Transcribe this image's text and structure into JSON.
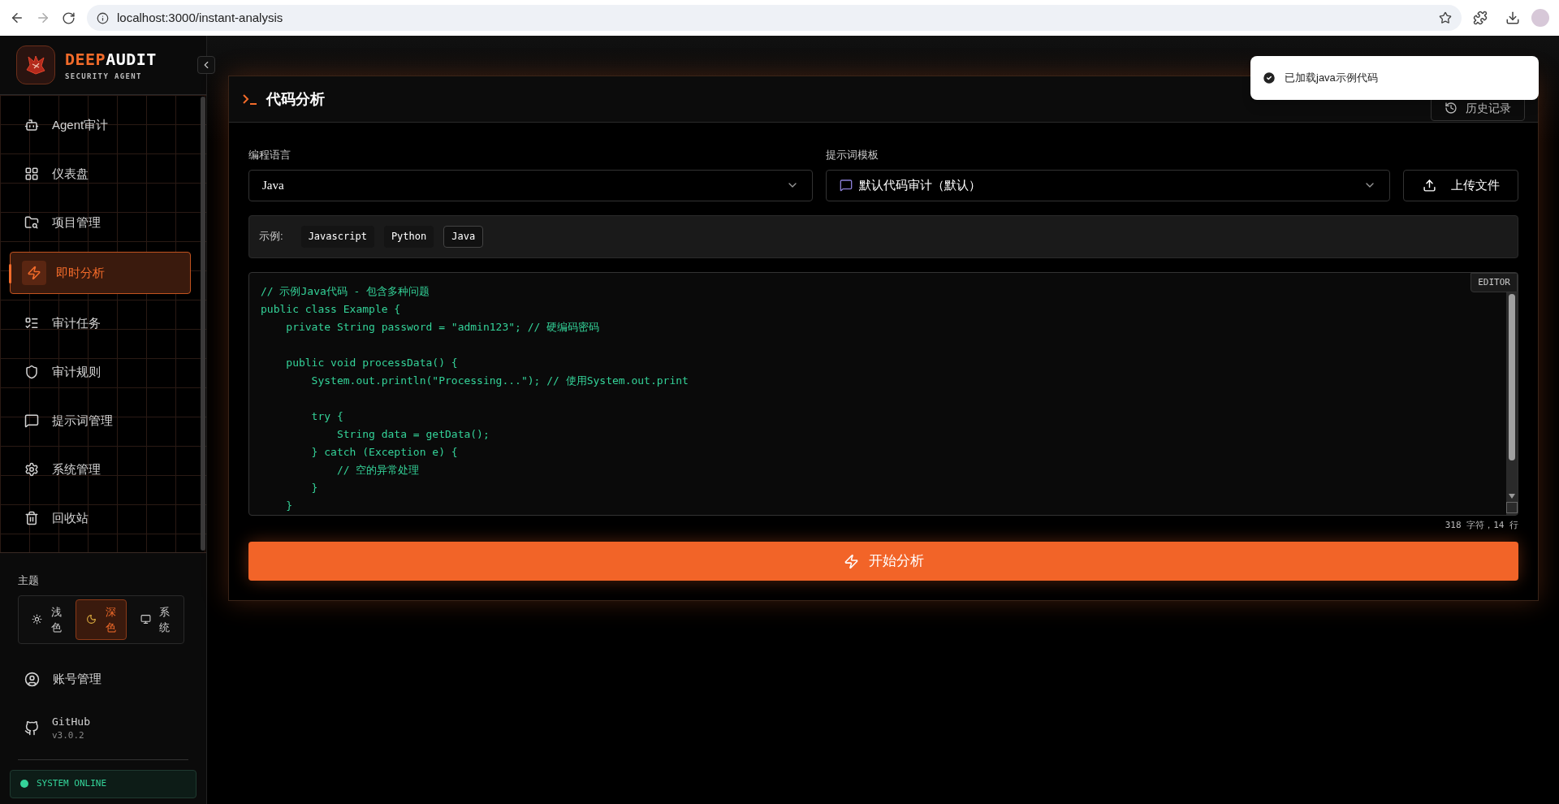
{
  "browser": {
    "url": "localhost:3000/instant-analysis"
  },
  "sidebar": {
    "brand": {
      "accent": "DEEP",
      "name": "AUDIT",
      "tagline": "SECURITY AGENT"
    },
    "items": [
      {
        "label": "Agent审计",
        "selected": false
      },
      {
        "label": "仪表盘",
        "selected": false
      },
      {
        "label": "项目管理",
        "selected": false
      },
      {
        "label": "即时分析",
        "selected": true
      },
      {
        "label": "审计任务",
        "selected": false
      },
      {
        "label": "审计规则",
        "selected": false
      },
      {
        "label": "提示词管理",
        "selected": false
      },
      {
        "label": "系统管理",
        "selected": false
      },
      {
        "label": "回收站",
        "selected": false
      }
    ],
    "theme": {
      "label": "主题",
      "options": [
        {
          "label": "浅色",
          "selected": false
        },
        {
          "label": "深色",
          "selected": true
        },
        {
          "label": "系统",
          "selected": false
        }
      ]
    },
    "account": {
      "label": "账号管理"
    },
    "github": {
      "label": "GitHub",
      "version": "v3.0.2"
    },
    "status": {
      "label": "SYSTEM ONLINE"
    }
  },
  "panel": {
    "title": "代码分析",
    "history_button": "历史记录",
    "language": {
      "label": "编程语言",
      "value": "Java"
    },
    "template": {
      "label": "提示词模板",
      "value": "默认代码审计（默认）"
    },
    "upload_button": "上传文件",
    "examples": {
      "label": "示例:",
      "items": [
        {
          "label": "Javascript",
          "selected": false
        },
        {
          "label": "Python",
          "selected": false
        },
        {
          "label": "Java",
          "selected": true
        }
      ]
    },
    "editor": {
      "badge": "EDITOR",
      "code": "// 示例Java代码 - 包含多种问题\npublic class Example {\n    private String password = \"admin123\"; // 硬编码密码\n\n    public void processData() {\n        System.out.println(\"Processing...\"); // 使用System.out.print\n\n        try {\n            String data = getData();\n        } catch (Exception e) {\n            // 空的异常处理\n        }\n    }"
    },
    "stats": "318 字符，14 行",
    "start_button": "开始分析"
  },
  "toast": {
    "message": "已加载java示例代码"
  }
}
